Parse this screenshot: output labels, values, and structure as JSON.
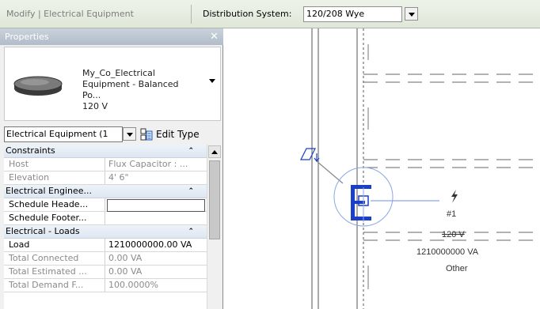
{
  "options_bar": {
    "context_label": "Modify | Electrical Equipment",
    "distribution_label": "Distribution System:",
    "distribution_value": "120/208 Wye"
  },
  "properties": {
    "title": "Properties",
    "close_glyph": "✕",
    "type_line1": "My_Co_Electrical",
    "type_line2": "Equipment - Balanced Po...",
    "type_line3": "120 V",
    "filter_value": "Electrical Equipment (1",
    "edit_type_label": "Edit Type",
    "groups": {
      "constraints": "Constraints",
      "engineering": "Electrical Enginee...",
      "loads": "Electrical - Loads"
    },
    "rows": {
      "host": {
        "key": "Host",
        "value": "Flux Capacitor : ..."
      },
      "elevation": {
        "key": "Elevation",
        "value": "4' 6\""
      },
      "schedule_header": {
        "key": "Schedule Heade...",
        "value": ""
      },
      "schedule_footer": {
        "key": "Schedule Footer...",
        "value": ""
      },
      "load": {
        "key": "Load",
        "value": "1210000000.00 VA"
      },
      "total_connected": {
        "key": "Total Connected",
        "value": "0.00 VA"
      },
      "total_estimated": {
        "key": "Total Estimated ...",
        "value": "0.00 VA"
      },
      "total_demand": {
        "key": "Total Demand F...",
        "value": "100.0000%"
      }
    }
  },
  "drawing": {
    "tag_number": "#1",
    "tag_voltage": "120 V",
    "tag_load": "1210000000 VA",
    "tag_type": "Other",
    "accent_color": "#1a3fc8",
    "wire_color": "#8aa7e6",
    "line_color": "#555555"
  }
}
